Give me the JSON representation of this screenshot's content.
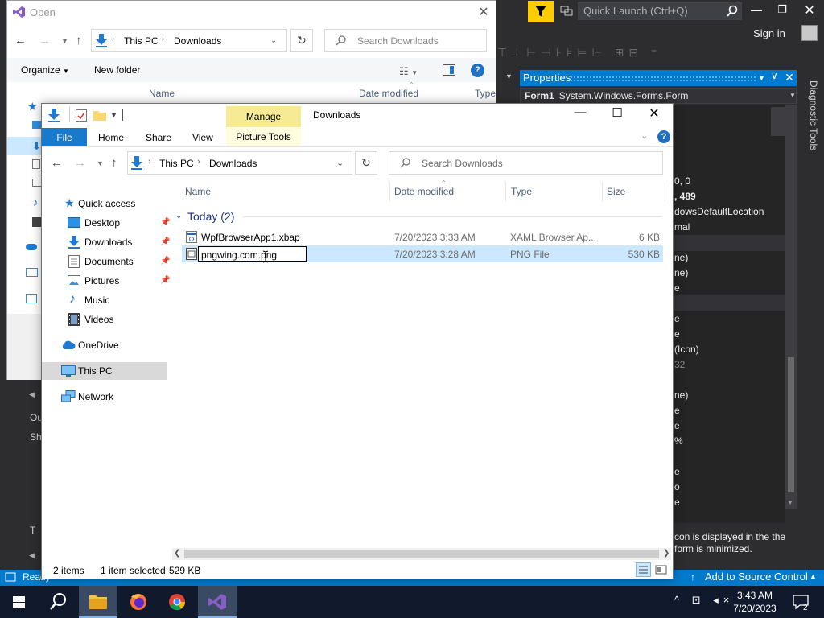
{
  "vs": {
    "quick_launch_placeholder": "Quick Launch (Ctrl+Q)",
    "sign_in": "Sign in",
    "toolbar_glyphs": "⊤⊥⊢⊣⊦⊧⊨⊩ ⊞⊟ ⁼",
    "properties_title": "Properties",
    "properties_object_name": "Form1",
    "properties_object_type": "System.Windows.Forms.Form",
    "prop_values": [
      "0, 0",
      ", 489",
      "dowsDefaultLocation",
      "mal",
      "ne)",
      "ne)",
      "e",
      "e",
      "e",
      "(Icon)",
      "32",
      "ne)",
      "e",
      "e",
      "%",
      "e",
      "o",
      "e"
    ],
    "description": "con is displayed in the the form is minimized.",
    "diagnostic_tools": "Diagnostic Tools",
    "left_text_1": "Ou",
    "left_text_2": "Sh",
    "left_text_3": "T",
    "status_ready": "Ready",
    "status_source_control": "Add to Source Control",
    "colors": {
      "accent": "#007acc",
      "bg": "#2d2d30",
      "filter": "#ffcc00"
    }
  },
  "open_dialog": {
    "title": "Open",
    "path": [
      "This PC",
      "Downloads"
    ],
    "search_placeholder": "Search Downloads",
    "organize": "Organize",
    "new_folder": "New folder",
    "columns": [
      "Name",
      "Date modified",
      "Type"
    ]
  },
  "explorer": {
    "title": "Downloads",
    "context_tab": "Manage",
    "context_group": "Picture Tools",
    "tabs": [
      "File",
      "Home",
      "Share",
      "View"
    ],
    "path": [
      "This PC",
      "Downloads"
    ],
    "search_placeholder": "Search Downloads",
    "nav": [
      {
        "label": "Quick access",
        "icon": "star-icon",
        "pinned": false
      },
      {
        "label": "Desktop",
        "icon": "desktop-icon",
        "pinned": true
      },
      {
        "label": "Downloads",
        "icon": "download-icon",
        "pinned": true
      },
      {
        "label": "Documents",
        "icon": "documents-icon",
        "pinned": true
      },
      {
        "label": "Pictures",
        "icon": "pictures-icon",
        "pinned": true
      },
      {
        "label": "Music",
        "icon": "music-icon",
        "pinned": false
      },
      {
        "label": "Videos",
        "icon": "videos-icon",
        "pinned": false
      },
      {
        "label": "OneDrive",
        "icon": "cloud-icon",
        "pinned": false
      },
      {
        "label": "This PC",
        "icon": "computer-icon",
        "pinned": false
      },
      {
        "label": "Network",
        "icon": "network-icon",
        "pinned": false
      }
    ],
    "columns": [
      "Name",
      "Date modified",
      "Type",
      "Size"
    ],
    "group_label": "Today (2)",
    "files": [
      {
        "name": "WpfBrowserApp1.xbap",
        "date": "7/20/2023 3:33 AM",
        "type": "XAML Browser Ap...",
        "size": "6 KB",
        "selected": false
      },
      {
        "name": "pngwing.com.png",
        "date": "7/20/2023 3:28 AM",
        "type": "PNG File",
        "size": "530 KB",
        "selected": true
      }
    ],
    "rename_value": "pngwing.com.png",
    "status": {
      "items": "2 items",
      "selected": "1 item selected",
      "size": "529 KB"
    }
  },
  "taskbar": {
    "time": "3:43 AM",
    "date": "7/20/2023",
    "notification_count": "2",
    "tray": "^ ⊡ ◂×"
  }
}
